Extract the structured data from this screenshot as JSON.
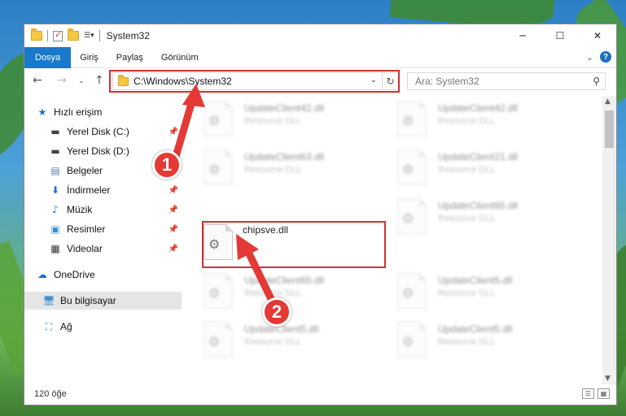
{
  "window": {
    "title": "System32",
    "controls": {
      "minimize": "─",
      "maximize": "☐",
      "close": "✕"
    }
  },
  "ribbon": {
    "tabs": [
      "Dosya",
      "Giriş",
      "Paylaş",
      "Görünüm"
    ],
    "active_tab": "Dosya",
    "accent_color": "#1979ca"
  },
  "address": {
    "path": "C:\\Windows\\System32",
    "search_placeholder": "Ara: System32"
  },
  "sidebar": {
    "items": [
      {
        "label": "Hızlı erişim",
        "icon": "star-icon"
      },
      {
        "label": "Yerel Disk (C:)",
        "icon": "drive-icon"
      },
      {
        "label": "Yerel Disk (D:)",
        "icon": "drive-icon"
      },
      {
        "label": "Belgeler",
        "icon": "documents-icon"
      },
      {
        "label": "İndirmeler",
        "icon": "download-icon"
      },
      {
        "label": "Müzik",
        "icon": "music-icon"
      },
      {
        "label": "Resimler",
        "icon": "pictures-icon"
      },
      {
        "label": "Videolar",
        "icon": "video-icon"
      },
      {
        "label": "OneDrive",
        "icon": "cloud-icon"
      },
      {
        "label": "Bu bilgisayar",
        "icon": "computer-icon"
      },
      {
        "label": "Ağ",
        "icon": "network-icon"
      }
    ],
    "selected": "Bu bilgisayar"
  },
  "files": [
    {
      "name": "UpdateClient42.dll",
      "type": "Resource DLL"
    },
    {
      "name": "UpdateClient42.dll",
      "type": "Resource DLL"
    },
    {
      "name": "UpdateClient63.dll",
      "type": "Resource DLL"
    },
    {
      "name": "UpdateClient21.dll",
      "type": "Resource DLL"
    },
    {
      "name": "chipsve.dll",
      "type": ""
    },
    {
      "name": "UpdateClient65.dll",
      "type": "Resource DLL"
    },
    {
      "name": "UpdateClient65.dll",
      "type": "Resource DLL"
    },
    {
      "name": "UpdateClient5.dll",
      "type": "Resource DLL"
    },
    {
      "name": "UpdateClient5.dll",
      "type": "Resource DLL"
    },
    {
      "name": "UpdateClient5.dll",
      "type": "Resource DLL"
    }
  ],
  "status": {
    "item_count": "120 öğe"
  },
  "annotations": {
    "marker1": "1",
    "marker2": "2",
    "highlight_color": "#d32f2f"
  }
}
